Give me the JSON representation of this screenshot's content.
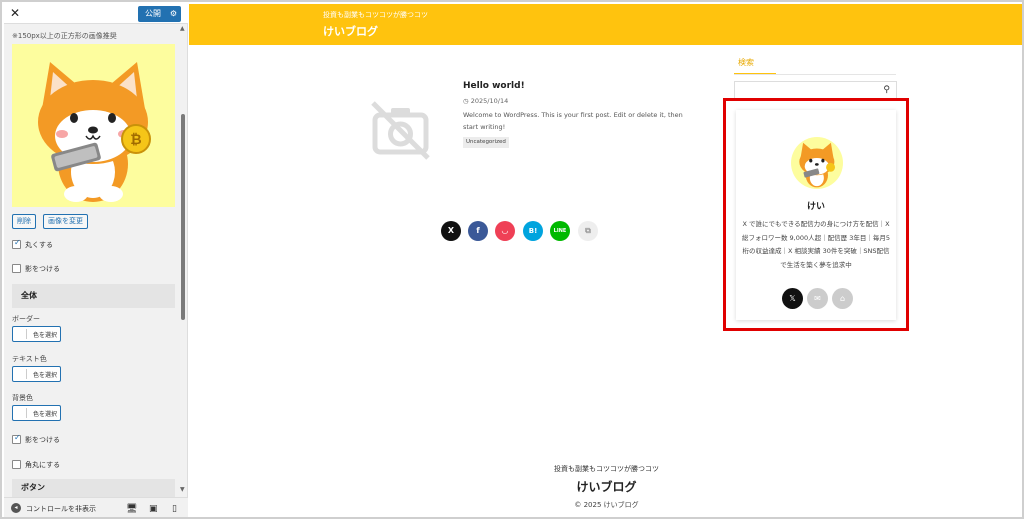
{
  "customizer": {
    "close_label": "✕",
    "publish_label": "公開",
    "image_note": "※150px以上の正方形の画像推奨",
    "delete_label": "削除",
    "change_image_label": "画像を変更",
    "round_label": "丸くする",
    "round_checked": true,
    "shadow_label": "影をつける",
    "shadow_checked": false,
    "section_overall": "全体",
    "border_label": "ボーダー",
    "text_color_label": "テキスト色",
    "bg_color_label": "背景色",
    "select_color_label": "色を選択",
    "shadow2_label": "影をつける",
    "shadow2_checked": true,
    "rounded_corner_label": "角丸にする",
    "rounded_corner_checked": false,
    "section_button": "ボタン",
    "hide_controls_label": "コントロールを非表示"
  },
  "site": {
    "tagline": "投資も副業もコツコツが勝つコツ",
    "title": "けいブログ",
    "accent_color": "#ffc30e"
  },
  "post": {
    "title": "Hello world!",
    "date": "2025/10/14",
    "excerpt": "Welcome to WordPress. This is your first post. Edit or delete it, then start writing!",
    "category": "Uncategorized"
  },
  "share": [
    "X",
    "f",
    "P",
    "B!",
    "LINE",
    "copy"
  ],
  "sidebar": {
    "search_tab": "検索",
    "profile_name": "けい",
    "profile_bio": "X で誰にでもできる配信力の身につけ方を配信｜X 総フォロワー数 9,000人超｜配信歴 3年目｜毎月5桁の収益達成｜X 相談実績 30件を突破｜SNS配信で生活を築く夢を追求中"
  },
  "footer": {
    "tagline": "投資も副業もコツコツが勝つコツ",
    "title": "けいブログ",
    "copyright": "© 2025 けいブログ"
  }
}
